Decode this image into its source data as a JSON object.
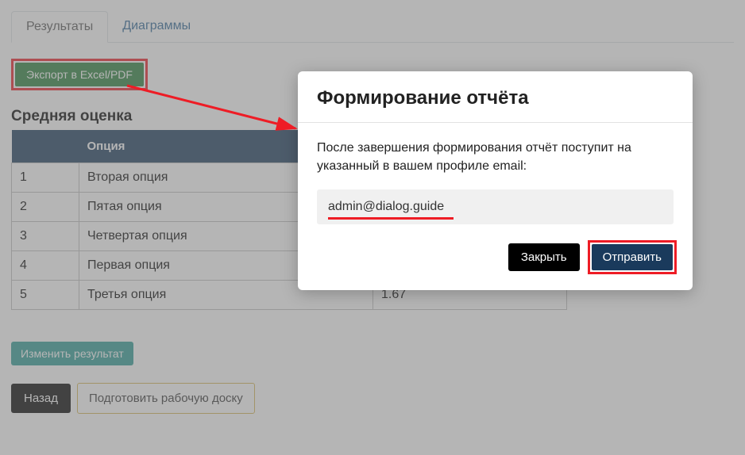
{
  "tabs": {
    "results": "Результаты",
    "diagrams": "Диаграммы"
  },
  "export_button": "Экспорт в Excel/PDF",
  "section_title": "Средняя оценка",
  "table": {
    "headers": {
      "num": "",
      "option": "Опция",
      "value": ""
    },
    "rows": [
      {
        "n": "1",
        "option": "Вторая опция",
        "value": ""
      },
      {
        "n": "2",
        "option": "Пятая опция",
        "value": ""
      },
      {
        "n": "3",
        "option": "Четвертая опция",
        "value": ""
      },
      {
        "n": "4",
        "option": "Первая опция",
        "value": ""
      },
      {
        "n": "5",
        "option": "Третья опция",
        "value": "1.67"
      }
    ]
  },
  "buttons": {
    "change_result": "Изменить результат",
    "back": "Назад",
    "prepare_board": "Подготовить рабочую доску"
  },
  "modal": {
    "title": "Формирование отчёта",
    "description": "После завершения формирования отчёт поступит на указанный в вашем профиле email:",
    "email": "admin@dialog.guide",
    "close": "Закрыть",
    "submit": "Отправить"
  }
}
